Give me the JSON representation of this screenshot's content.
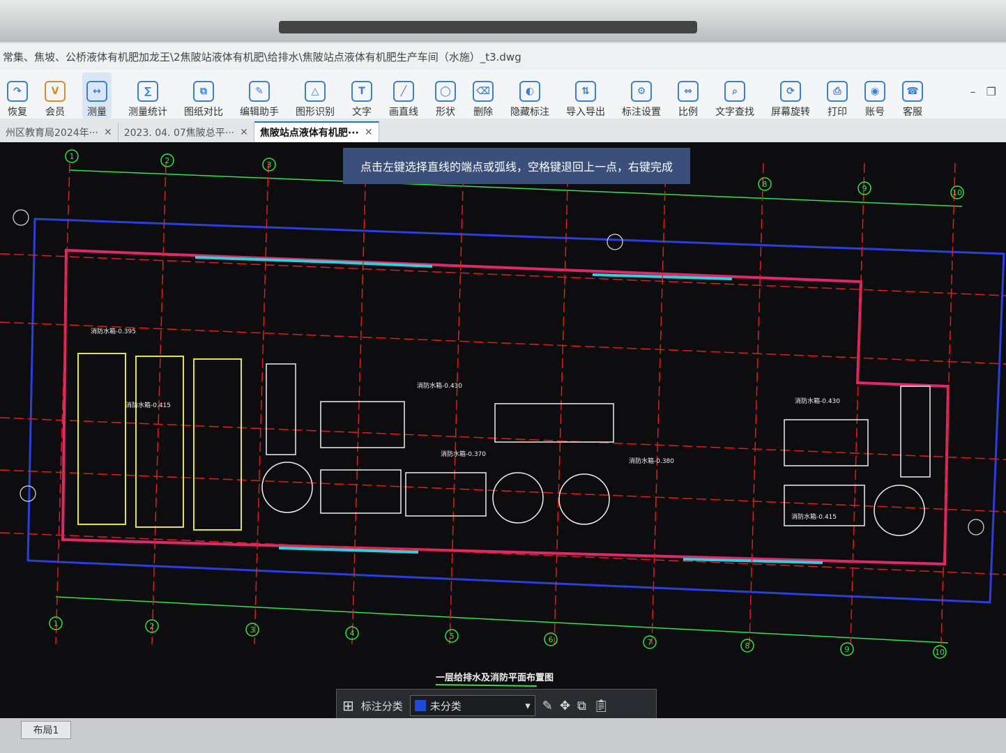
{
  "window": {
    "title": "常集、焦坡、公桥液体有机肥加龙王\\2焦陂站液体有机肥\\给排水\\焦陂站点液体有机肥生产车间（水施）_t3.dwg"
  },
  "toolbar": {
    "items": [
      {
        "label": "恢复",
        "icon": "redo-icon"
      },
      {
        "label": "会员",
        "icon": "vip-icon"
      },
      {
        "label": "测量",
        "icon": "ruler-icon"
      },
      {
        "label": "测量统计",
        "icon": "measure-stats-icon"
      },
      {
        "label": "图纸对比",
        "icon": "compare-icon"
      },
      {
        "label": "编辑助手",
        "icon": "edit-assistant-icon"
      },
      {
        "label": "图形识别",
        "icon": "shape-recognition-icon"
      },
      {
        "label": "文字",
        "icon": "text-icon"
      },
      {
        "label": "画直线",
        "icon": "line-icon"
      },
      {
        "label": "形状",
        "icon": "shape-icon"
      },
      {
        "label": "删除",
        "icon": "eraser-icon"
      },
      {
        "label": "隐藏标注",
        "icon": "hide-annotation-icon"
      },
      {
        "label": "导入导出",
        "icon": "import-export-icon"
      },
      {
        "label": "标注设置",
        "icon": "annotation-settings-icon"
      },
      {
        "label": "比例",
        "icon": "scale-icon"
      },
      {
        "label": "文字查找",
        "icon": "text-search-icon"
      },
      {
        "label": "屏幕旋转",
        "icon": "rotate-screen-icon"
      },
      {
        "label": "打印",
        "icon": "print-icon"
      },
      {
        "label": "账号",
        "icon": "account-icon"
      },
      {
        "label": "客服",
        "icon": "support-icon"
      }
    ]
  },
  "tabs": [
    {
      "label": "州区教育局2024年···",
      "active": false
    },
    {
      "label": "2023. 04. 07焦陂总平···",
      "active": false
    },
    {
      "label": "焦陂站点液体有机肥···",
      "active": true
    }
  ],
  "hint": "点击左键选择直线的端点或弧线，空格键退回上一点，右键完成",
  "drawing": {
    "title": "一层给排水及消防平面布置图",
    "axis_labels_top": [
      "1",
      "2",
      "3",
      "8",
      "9",
      "10"
    ],
    "axis_labels_bottom": [
      "1",
      "2",
      "3",
      "4",
      "5",
      "6",
      "7",
      "8",
      "9",
      "10"
    ],
    "notes": [
      "消防水箱-0.395",
      "消防水箱-0.415",
      "消防水箱-0.430",
      "消防水箱-0.370",
      "消防水箱-0.380",
      "消防水箱-0.430",
      "消防水箱-0.415"
    ]
  },
  "bottombar": {
    "category_label": "标注分类",
    "category_value": "未分类"
  },
  "layout": {
    "tab_label": "布局1"
  }
}
